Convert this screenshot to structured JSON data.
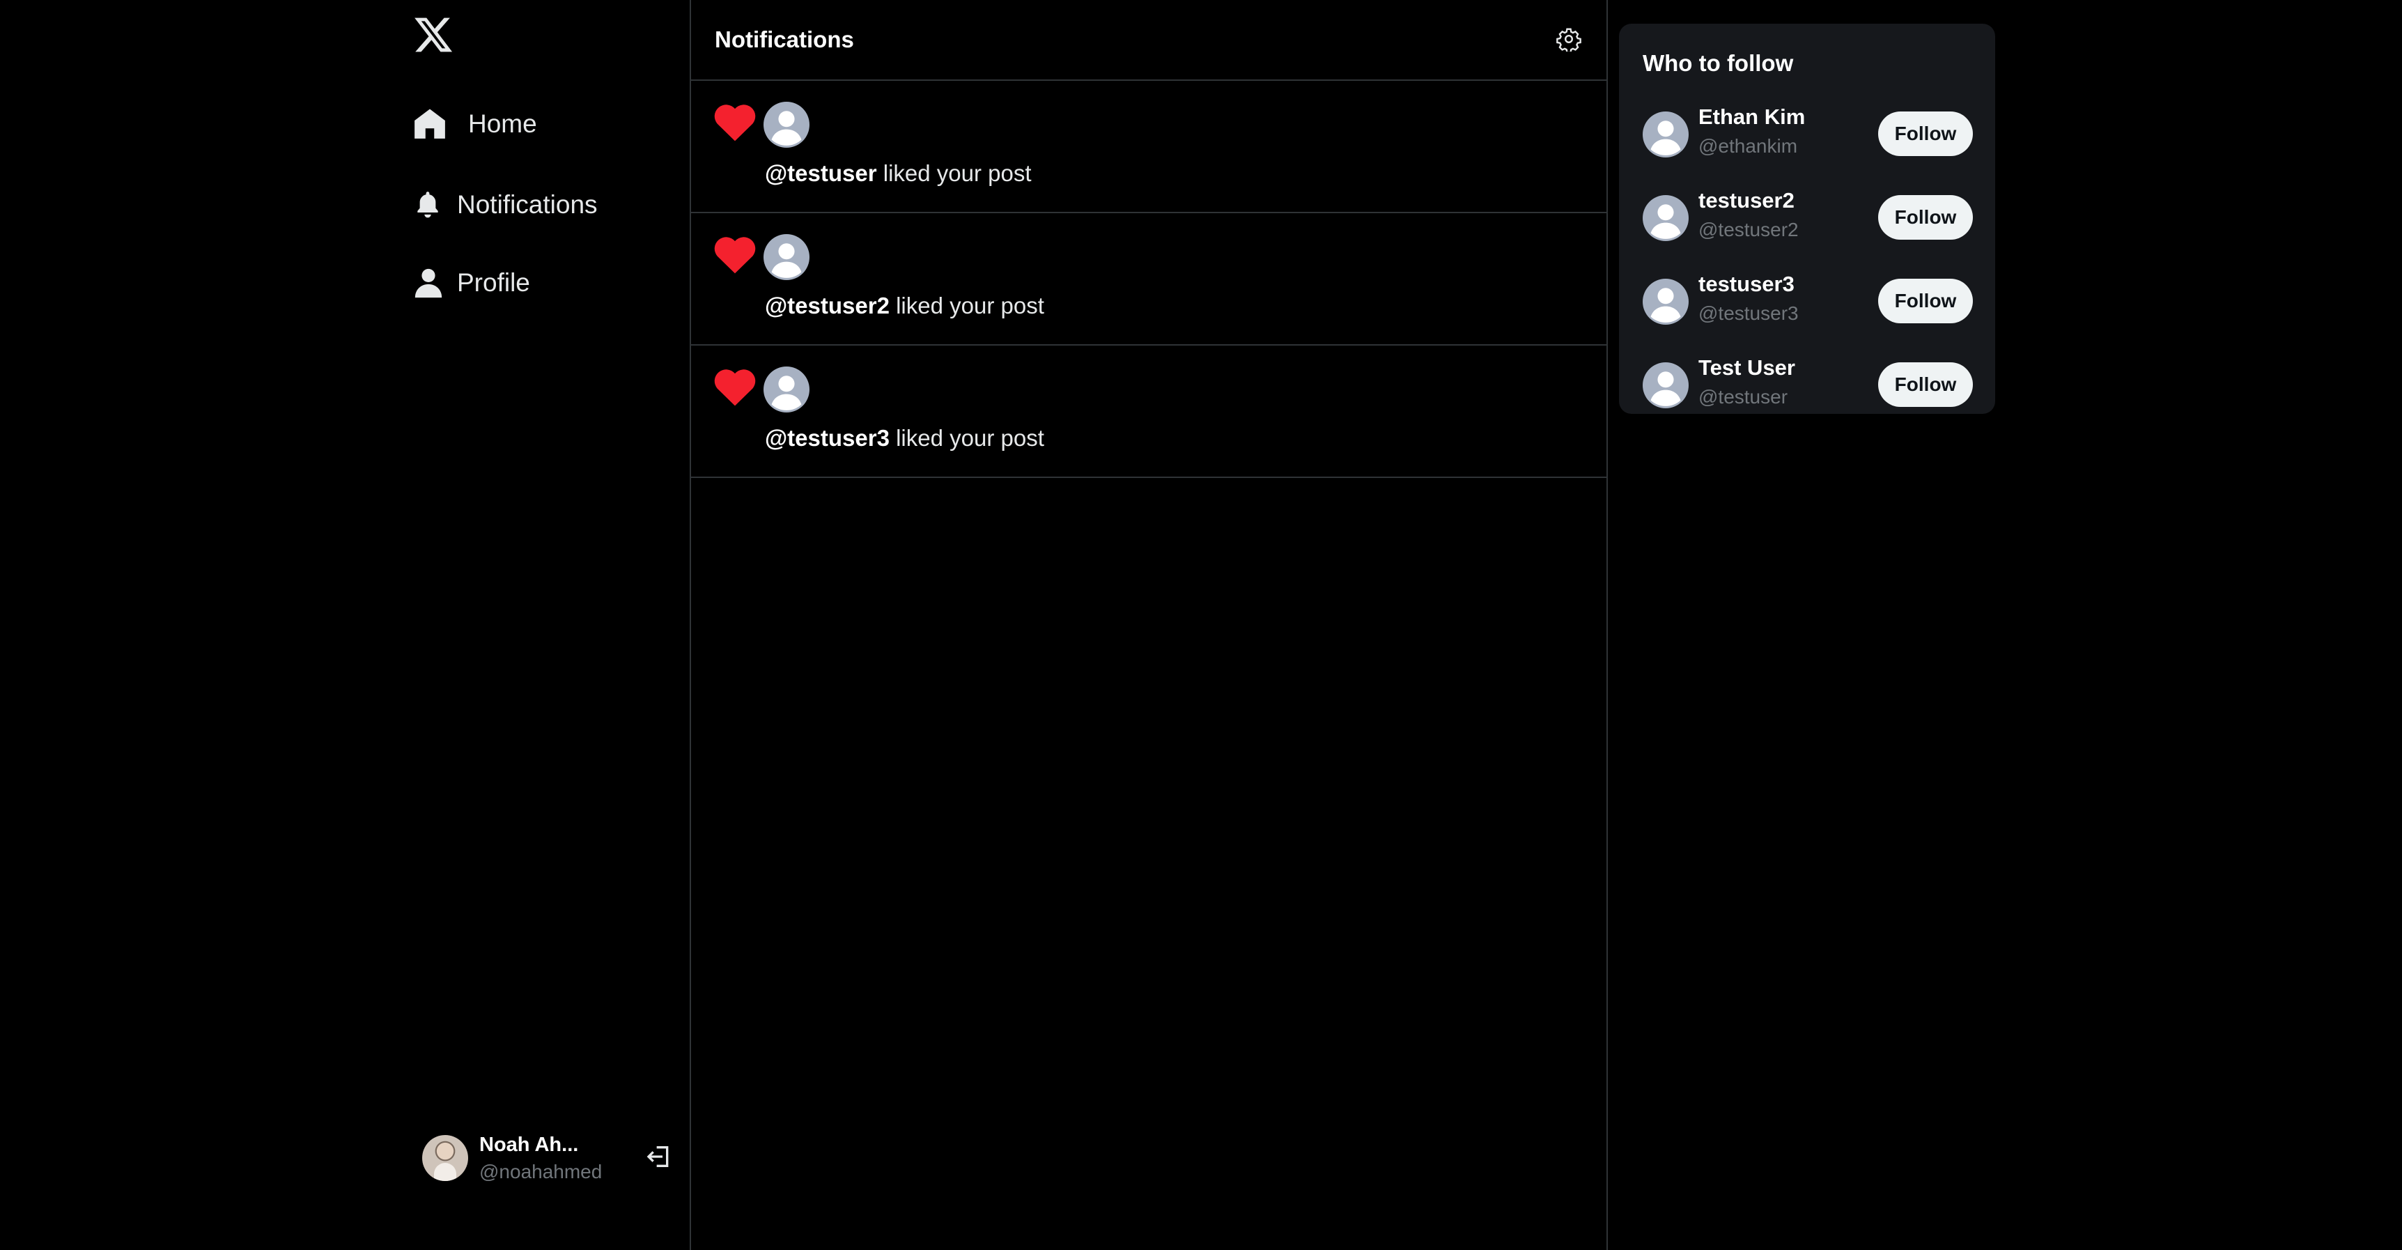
{
  "sidebar": {
    "logo_icon": "x-logo-icon",
    "nav": [
      {
        "label": "Home",
        "icon": "home-icon"
      },
      {
        "label": "Notifications",
        "icon": "bell-icon"
      },
      {
        "label": "Profile",
        "icon": "person-icon"
      }
    ],
    "account": {
      "name": "Noah Ah...",
      "handle": "@noahahmed",
      "logout_icon": "logout-icon"
    }
  },
  "main": {
    "title": "Notifications",
    "settings_icon": "gear-icon",
    "notifications": [
      {
        "user": "@testuser",
        "action": "liked your post",
        "icon": "heart-icon"
      },
      {
        "user": "@testuser2",
        "action": "liked your post",
        "icon": "heart-icon"
      },
      {
        "user": "@testuser3",
        "action": "liked your post",
        "icon": "heart-icon"
      }
    ]
  },
  "who_to_follow": {
    "title": "Who to follow",
    "button_label": "Follow",
    "users": [
      {
        "name": "Ethan Kim",
        "handle": "@ethankim"
      },
      {
        "name": "testuser2",
        "handle": "@testuser2"
      },
      {
        "name": "testuser3",
        "handle": "@testuser3"
      },
      {
        "name": "Test User",
        "handle": "@testuser"
      }
    ]
  },
  "colors": {
    "background": "#000000",
    "border": "#2f3336",
    "card": "#16181c",
    "muted_text": "#71767b",
    "heart": "#f91880",
    "avatar_placeholder": "#a7b1c2"
  }
}
